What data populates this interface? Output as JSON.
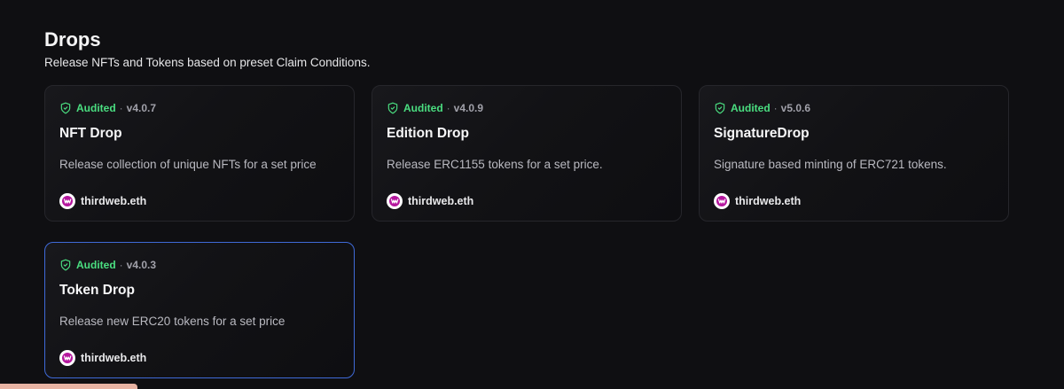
{
  "section": {
    "title": "Drops",
    "subtitle": "Release NFTs and Tokens based on preset Claim Conditions."
  },
  "cards": [
    {
      "audited_label": "Audited",
      "separator": "·",
      "version": "v4.0.7",
      "title": "NFT Drop",
      "description": "Release collection of unique NFTs for a set price",
      "author": "thirdweb.eth"
    },
    {
      "audited_label": "Audited",
      "separator": "·",
      "version": "v4.0.9",
      "title": "Edition Drop",
      "description": "Release ERC1155 tokens for a set price.",
      "author": "thirdweb.eth"
    },
    {
      "audited_label": "Audited",
      "separator": "·",
      "version": "v5.0.6",
      "title": "SignatureDrop",
      "description": "Signature based minting of ERC721 tokens.",
      "author": "thirdweb.eth"
    },
    {
      "audited_label": "Audited",
      "separator": "·",
      "version": "v4.0.3",
      "title": "Token Drop",
      "description": "Release new ERC20 tokens for a set price",
      "author": "thirdweb.eth"
    }
  ],
  "colors": {
    "background": "#0f0f12",
    "audited": "#4ade80",
    "highlight_border": "#3f6ad8",
    "brand_avatar": "#b5179e"
  },
  "icons": {
    "audited": "shield-check-icon",
    "author": "thirdweb-logo-icon"
  }
}
